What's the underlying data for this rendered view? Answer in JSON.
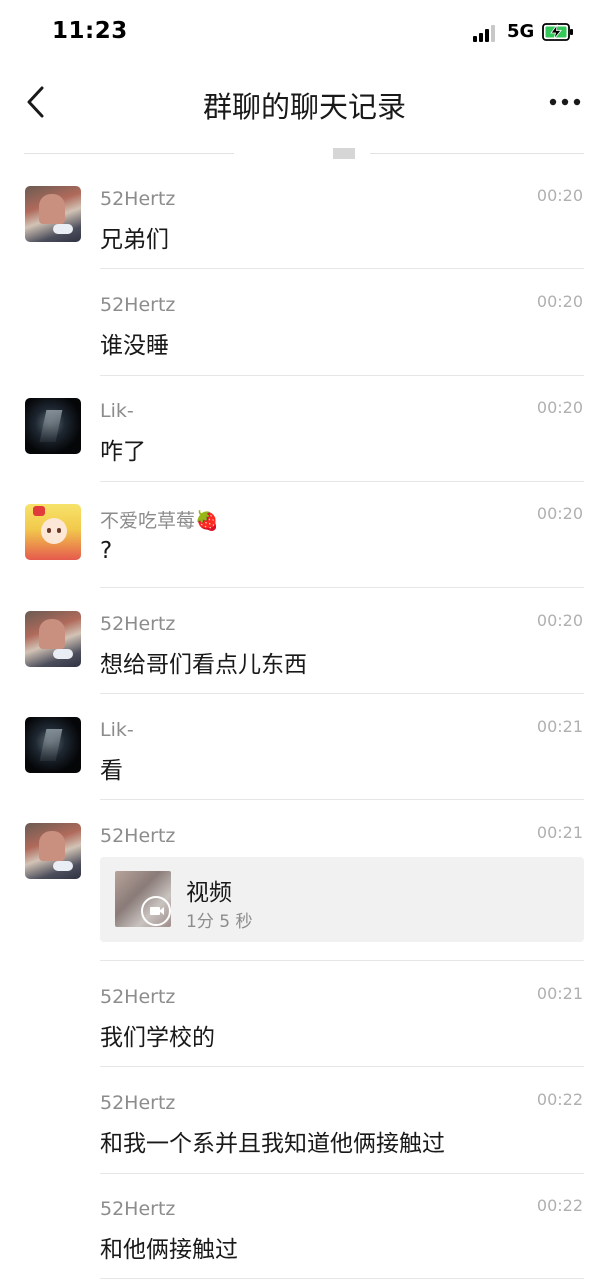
{
  "status_bar": {
    "time": "11:23",
    "network": "5G"
  },
  "nav": {
    "title": "群聊的聊天记录"
  },
  "messages": [
    {
      "sender": "52Hertz",
      "time": "00:20",
      "text": "兄弟们",
      "avatar": "52hertz-avatar"
    },
    {
      "sender": "52Hertz",
      "time": "00:20",
      "text": "谁没睡",
      "avatar": null
    },
    {
      "sender": "Lik-",
      "time": "00:20",
      "text": "咋了",
      "avatar": "lik-avatar"
    },
    {
      "sender": "不爱吃草莓🍓",
      "time": "00:20",
      "text": "?",
      "avatar": "anime-girl-avatar"
    },
    {
      "sender": "52Hertz",
      "time": "00:20",
      "text": "想给哥们看点儿东西",
      "avatar": "52hertz-avatar"
    },
    {
      "sender": "Lik-",
      "time": "00:21",
      "text": "看",
      "avatar": "lik-avatar"
    },
    {
      "sender": "52Hertz",
      "time": "00:21",
      "avatar": "52hertz-avatar",
      "video": {
        "title": "视频",
        "duration": "1分 5 秒"
      }
    },
    {
      "sender": "52Hertz",
      "time": "00:21",
      "text": "我们学校的",
      "avatar": null
    },
    {
      "sender": "52Hertz",
      "time": "00:22",
      "text": "和我一个系并且我知道他俩接触过",
      "avatar": null
    },
    {
      "sender": "52Hertz",
      "time": "00:22",
      "text": "和他俩接触过",
      "avatar": null
    }
  ]
}
